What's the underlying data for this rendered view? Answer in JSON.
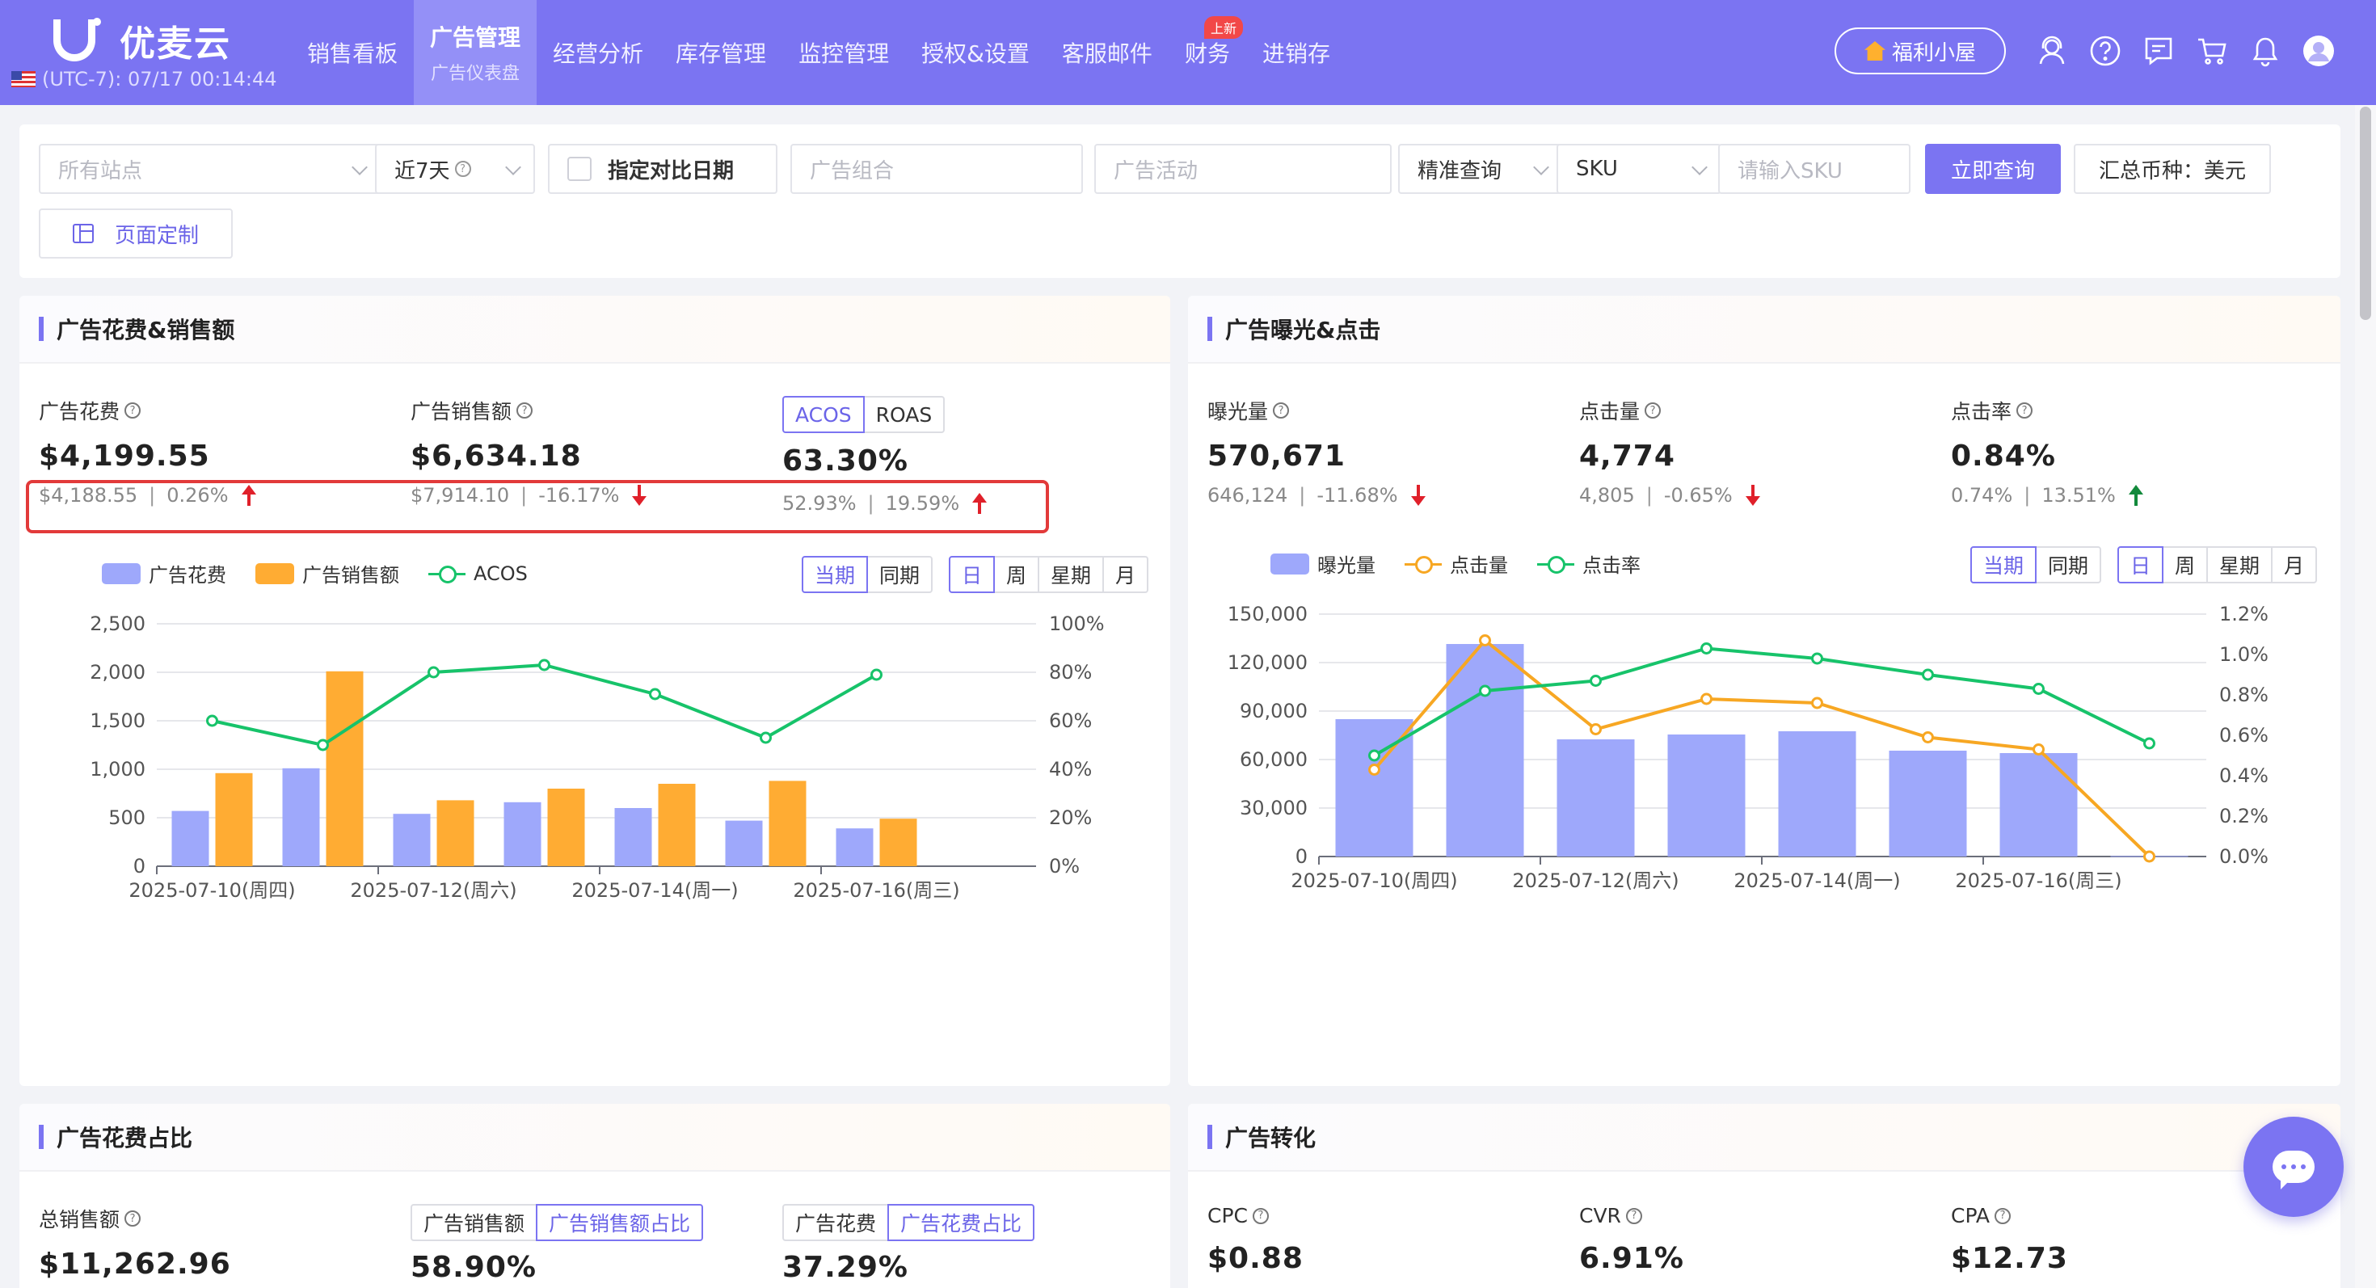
{
  "app": {
    "logo_text": "优麦云",
    "clock": "(UTC-7): 07/17 00:14:44"
  },
  "nav": {
    "items": [
      {
        "label": "销售看板"
      },
      {
        "label": "广告管理",
        "sub": "广告仪表盘",
        "active": true
      },
      {
        "label": "经营分析"
      },
      {
        "label": "库存管理"
      },
      {
        "label": "监控管理"
      },
      {
        "label": "授权&设置"
      },
      {
        "label": "客服邮件"
      },
      {
        "label": "财务",
        "badge": "上新"
      },
      {
        "label": "进销存"
      }
    ],
    "welfare_label": "福利小屋",
    "icons": [
      "user-support-icon",
      "help-icon",
      "message-icon",
      "cart-icon",
      "bell-icon",
      "avatar-icon"
    ]
  },
  "filters": {
    "site_placeholder": "所有站点",
    "date_range": "近7天",
    "compare_label": "指定对比日期",
    "ad_group_placeholder": "广告组合",
    "campaign_placeholder": "广告活动",
    "match_mode": "精准查询",
    "id_type": "SKU",
    "sku_placeholder": "请输入SKU",
    "query_button": "立即查询",
    "currency_button": "汇总币种：美元",
    "customize_button": "页面定制"
  },
  "panel_spend_sales": {
    "title": "广告花费&销售额",
    "metrics": [
      {
        "label": "广告花费",
        "value": "$4,199.55",
        "compare": "$4,188.55",
        "change": "0.26%",
        "trend": "up-red"
      },
      {
        "label": "广告销售额",
        "value": "$6,634.18",
        "compare": "$7,914.10",
        "change": "-16.17%",
        "trend": "down-red"
      },
      {
        "value": "63.30%",
        "compare": "52.93%",
        "change": "19.59%",
        "trend": "up-red"
      }
    ],
    "toggle": [
      "ACOS",
      "ROAS"
    ],
    "period": [
      "当期",
      "同期"
    ],
    "granularity": [
      "日",
      "周",
      "星期",
      "月"
    ],
    "legend": [
      "广告花费",
      "广告销售额",
      "ACOS"
    ]
  },
  "panel_impr_click": {
    "title": "广告曝光&点击",
    "metrics": [
      {
        "label": "曝光量",
        "value": "570,671",
        "compare": "646,124",
        "change": "-11.68%",
        "trend": "down-red"
      },
      {
        "label": "点击量",
        "value": "4,774",
        "compare": "4,805",
        "change": "-0.65%",
        "trend": "down-red"
      },
      {
        "label": "点击率",
        "value": "0.84%",
        "compare": "0.74%",
        "change": "13.51%",
        "trend": "up-green"
      }
    ],
    "period": [
      "当期",
      "同期"
    ],
    "granularity": [
      "日",
      "周",
      "星期",
      "月"
    ],
    "legend": [
      "曝光量",
      "点击量",
      "点击率"
    ]
  },
  "panel_spend_share": {
    "title": "广告花费占比",
    "metrics": [
      {
        "label": "总销售额",
        "value": "$11,262.96"
      },
      {
        "value": "58.90%",
        "toggle": [
          "广告销售额",
          "广告销售额占比"
        ]
      },
      {
        "value": "37.29%",
        "toggle": [
          "广告花费",
          "广告花费占比"
        ]
      }
    ]
  },
  "panel_conversion": {
    "title": "广告转化",
    "metrics": [
      {
        "label": "CPC",
        "value": "$0.88"
      },
      {
        "label": "CVR",
        "value": "6.91%"
      },
      {
        "label": "CPA",
        "value": "$12.73"
      }
    ]
  },
  "colors": {
    "primary": "#7b74f2",
    "bar_blue": "#9ea8fb",
    "bar_orange": "#ffac33",
    "line_green": "#17c36a",
    "line_orange": "#f7a723",
    "highlight": "#e23a3a"
  },
  "chart_data": [
    {
      "type": "bar",
      "categories": [
        "2025-07-10(周四)",
        "2025-07-11",
        "2025-07-12(周六)",
        "2025-07-13",
        "2025-07-14(周一)",
        "2025-07-15",
        "2025-07-16(周三)"
      ],
      "x_tick_labels": [
        "2025-07-10(周四)",
        "2025-07-12(周六)",
        "2025-07-14(周一)",
        "2025-07-16(周三)"
      ],
      "series": [
        {
          "name": "广告花费",
          "type": "bar",
          "axis": "left",
          "values": [
            570,
            1010,
            540,
            660,
            600,
            470,
            390
          ]
        },
        {
          "name": "广告销售额",
          "type": "bar",
          "axis": "left",
          "values": [
            960,
            2010,
            680,
            800,
            850,
            880,
            490
          ]
        },
        {
          "name": "ACOS",
          "type": "line",
          "axis": "right",
          "values": [
            60,
            50,
            80,
            83,
            71,
            53,
            79
          ]
        }
      ],
      "ylim": [
        0,
        2500
      ],
      "y_ticks": [
        "0",
        "500",
        "1,000",
        "1,500",
        "2,000",
        "2,500"
      ],
      "y2lim": [
        0,
        100
      ],
      "y2_ticks": [
        "0%",
        "20%",
        "40%",
        "60%",
        "80%",
        "100%"
      ],
      "grid": true
    },
    {
      "type": "bar",
      "categories": [
        "2025-07-10(周四)",
        "2025-07-11",
        "2025-07-12(周六)",
        "2025-07-13",
        "2025-07-14(周一)",
        "2025-07-15",
        "2025-07-16(周三)",
        "2025-07-17"
      ],
      "x_tick_labels": [
        "2025-07-10(周四)",
        "2025-07-12(周六)",
        "2025-07-14(周一)",
        "2025-07-16(周三)"
      ],
      "series": [
        {
          "name": "曝光量",
          "type": "bar",
          "axis": "left",
          "values": [
            85000,
            131500,
            72500,
            75500,
            77500,
            65500,
            64000,
            300
          ]
        },
        {
          "name": "点击量",
          "type": "line",
          "axis": "right",
          "values": [
            0.43,
            1.07,
            0.63,
            0.78,
            0.76,
            0.59,
            0.53,
            0.0
          ]
        },
        {
          "name": "点击率",
          "type": "line",
          "axis": "right",
          "values": [
            0.5,
            0.82,
            0.87,
            1.03,
            0.98,
            0.9,
            0.83,
            0.56
          ]
        }
      ],
      "ylim": [
        0,
        150000
      ],
      "y_ticks": [
        "0",
        "30,000",
        "60,000",
        "90,000",
        "120,000",
        "150,000"
      ],
      "y2lim": [
        0,
        1.2
      ],
      "y2_ticks": [
        "0.0%",
        "0.2%",
        "0.4%",
        "0.6%",
        "0.8%",
        "1.0%",
        "1.2%"
      ],
      "grid": true
    }
  ]
}
